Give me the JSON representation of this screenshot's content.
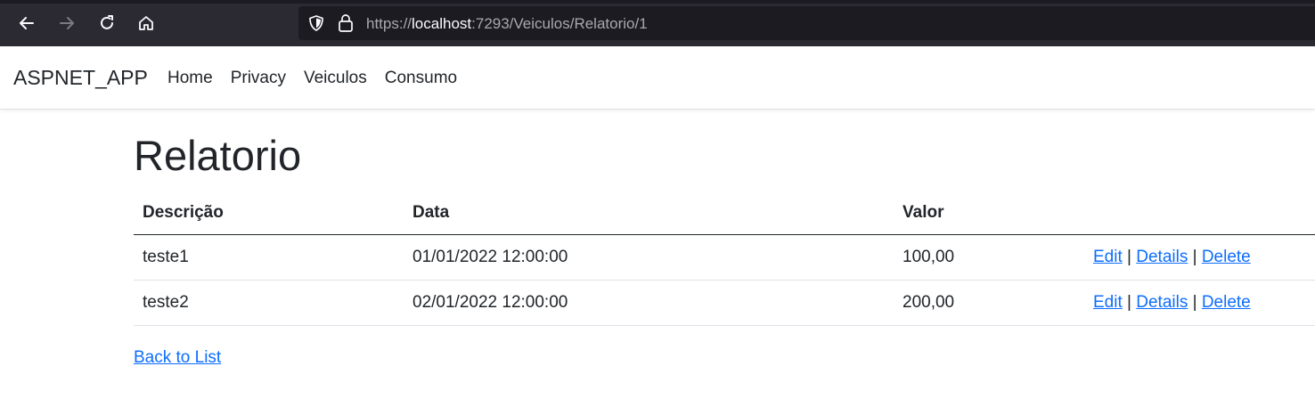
{
  "browser": {
    "url_scheme": "https://",
    "url_host": "localhost",
    "url_path": ":7293/Veiculos/Relatorio/1"
  },
  "navbar": {
    "brand": "ASPNET_APP",
    "links": [
      "Home",
      "Privacy",
      "Veiculos",
      "Consumo"
    ]
  },
  "page": {
    "title": "Relatorio",
    "table": {
      "headers": [
        "Descrição",
        "Data",
        "Valor",
        ""
      ],
      "rows": [
        {
          "descricao": "teste1",
          "data": "01/01/2022 12:00:00",
          "valor": "100,00"
        },
        {
          "descricao": "teste2",
          "data": "02/01/2022 12:00:00",
          "valor": "200,00"
        }
      ],
      "actions": {
        "edit": "Edit",
        "details": "Details",
        "delete": "Delete",
        "separator": "|"
      }
    },
    "back_link": "Back to List"
  },
  "colors": {
    "link": "#0d6efd",
    "text": "#212529",
    "browser_chrome": "#2b2a33",
    "url_bar": "#1c1b22"
  },
  "icons": [
    "back-arrow-icon",
    "forward-arrow-icon",
    "reload-icon",
    "home-icon",
    "shield-icon",
    "lock-icon"
  ]
}
